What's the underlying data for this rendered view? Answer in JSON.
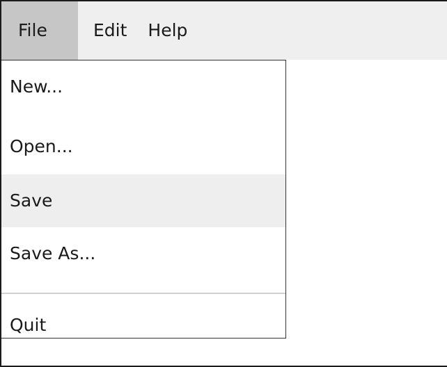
{
  "menubar": {
    "items": [
      {
        "label": "File",
        "active": true
      },
      {
        "label": "Edit",
        "active": false
      },
      {
        "label": "Help",
        "active": false
      }
    ]
  },
  "file_menu": {
    "items": [
      {
        "label": "New...",
        "highlighted": false
      },
      {
        "label": "Open...",
        "highlighted": false
      },
      {
        "label": "Save",
        "highlighted": true
      },
      {
        "label": "Save As...",
        "highlighted": false
      },
      {
        "label": "Quit",
        "highlighted": false
      }
    ]
  },
  "colors": {
    "menubar_bg": "#efefef",
    "active_menu_bg": "#c6c6c6",
    "highlight_bg": "#eeeeee",
    "separator": "#d0d0d0"
  }
}
